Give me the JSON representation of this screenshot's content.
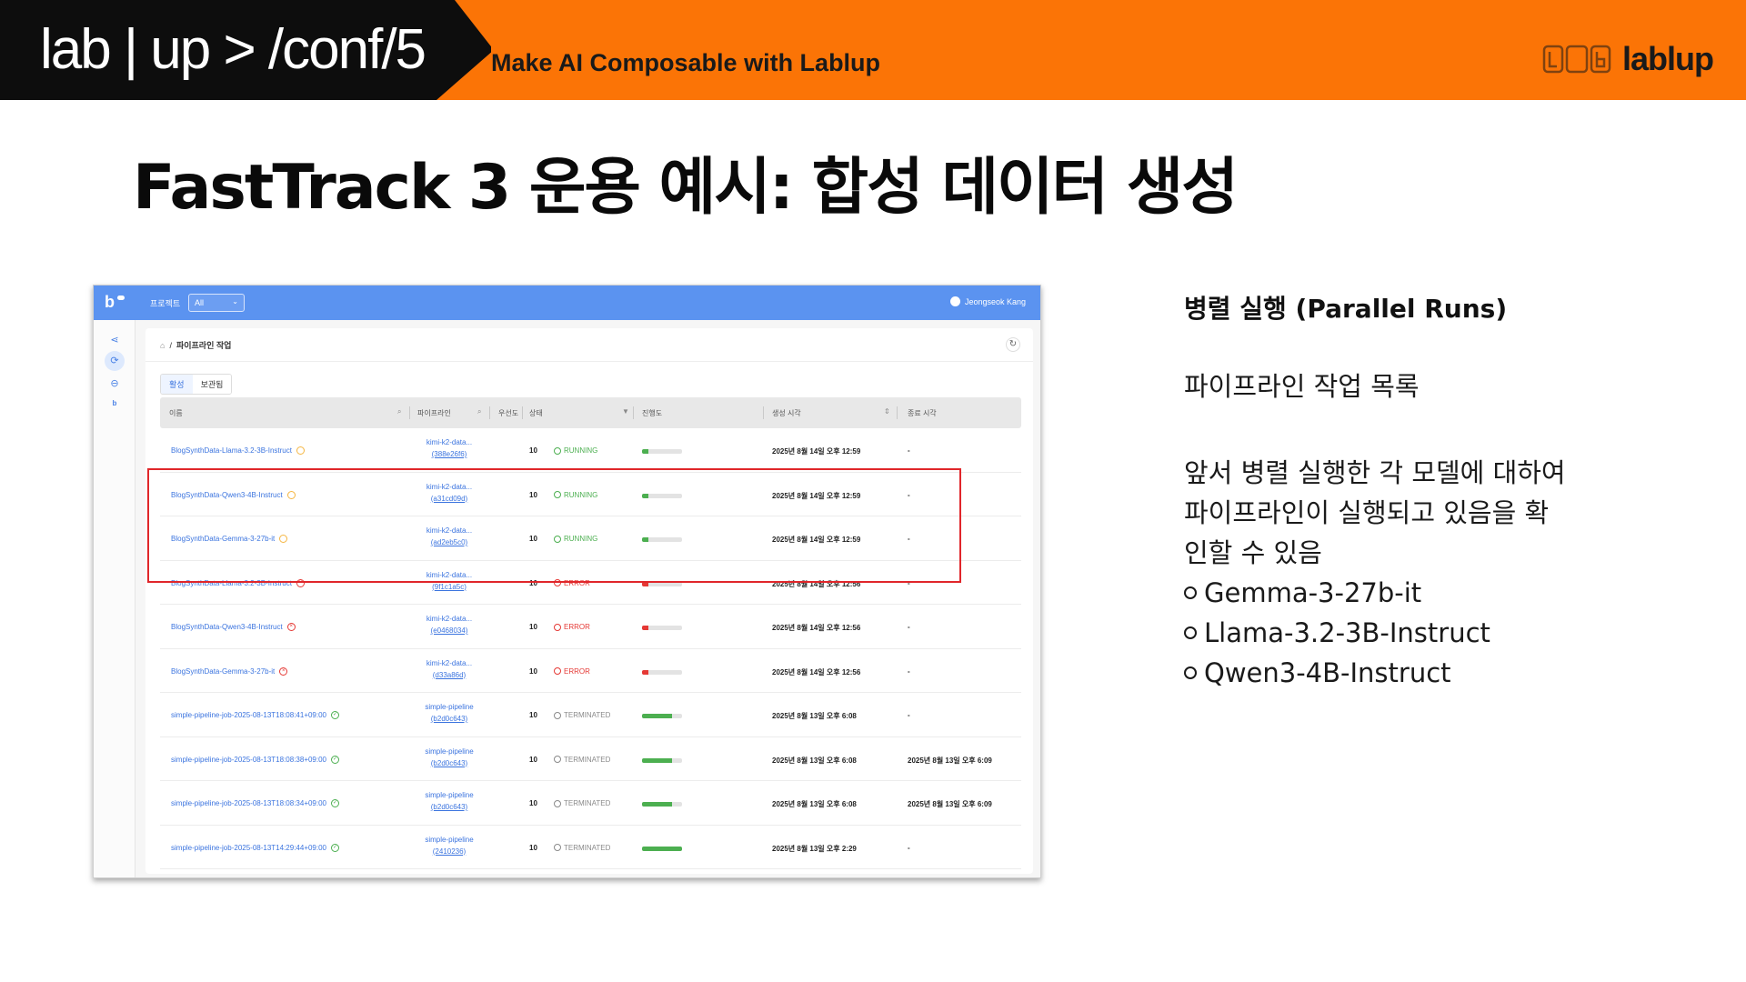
{
  "slide": {
    "brand": "lab | up > /conf/5",
    "tagline": "Make AI Composable with Lablup",
    "logo_word": "lablup",
    "title": "FastTrack 3 운용 예시: 합성 데이터 생성"
  },
  "side": {
    "heading": "병렬 실행 (Parallel Runs)",
    "subheading": "파이프라인 작업 목록",
    "description": "앞서 병렬 실행한 각 모델에 대하여 파이프라인이 실행되고 있음을 확인할 수 있음",
    "models": [
      "Gemma-3-27b-it",
      "Llama-3.2-3B-Instruct",
      "Qwen3-4B-Instruct"
    ]
  },
  "app": {
    "logo": "b",
    "project_label": "프로젝트",
    "project_value": "All",
    "user_name": "Jeongseok Kang",
    "breadcrumb_sep": "/",
    "breadcrumb_page": "파이프라인 작업",
    "tabs": [
      "활성",
      "보관됨"
    ],
    "active_tab": "활성",
    "colors": {
      "running": "#4caf50",
      "error": "#e53935",
      "terminated": "#8a8a8a",
      "link": "#3b74df",
      "topbar": "#5b93f0"
    },
    "columns": [
      "이름",
      "파이프라인",
      "우선도",
      "상태",
      "진행도",
      "생성 시각",
      "종료 시각"
    ],
    "jobs": [
      {
        "name": "BlogSynthData-Llama-3.2-3B-Instruct",
        "pipeline": "kimi-k2-data...",
        "pipeline_id": "(388e26f6)",
        "priority": "10",
        "status": "RUNNING",
        "progress": 0.15,
        "created": "2025년 8월 14일 오후 12:59",
        "ended": "-"
      },
      {
        "name": "BlogSynthData-Qwen3-4B-Instruct",
        "pipeline": "kimi-k2-data...",
        "pipeline_id": "(a31cd09d)",
        "priority": "10",
        "status": "RUNNING",
        "progress": 0.15,
        "created": "2025년 8월 14일 오후 12:59",
        "ended": "-"
      },
      {
        "name": "BlogSynthData-Gemma-3-27b-it",
        "pipeline": "kimi-k2-data...",
        "pipeline_id": "(ad2eb5c0)",
        "priority": "10",
        "status": "RUNNING",
        "progress": 0.15,
        "created": "2025년 8월 14일 오후 12:59",
        "ended": "-"
      },
      {
        "name": "BlogSynthData-Llama-3.2-3B-Instruct",
        "pipeline": "kimi-k2-data...",
        "pipeline_id": "(9f1c1a5c)",
        "priority": "10",
        "status": "ERROR",
        "progress": 0.15,
        "created": "2025년 8월 14일 오후 12:56",
        "ended": "-"
      },
      {
        "name": "BlogSynthData-Qwen3-4B-Instruct",
        "pipeline": "kimi-k2-data...",
        "pipeline_id": "(e0468034)",
        "priority": "10",
        "status": "ERROR",
        "progress": 0.15,
        "created": "2025년 8월 14일 오후 12:56",
        "ended": "-"
      },
      {
        "name": "BlogSynthData-Gemma-3-27b-it",
        "pipeline": "kimi-k2-data...",
        "pipeline_id": "(d33a86d)",
        "priority": "10",
        "status": "ERROR",
        "progress": 0.15,
        "created": "2025년 8월 14일 오후 12:56",
        "ended": "-"
      },
      {
        "name": "simple-pipeline-job-2025-08-13T18:08:41+09:00",
        "pipeline": "simple-pipeline",
        "pipeline_id": "(b2d0c643)",
        "priority": "10",
        "status": "TERMINATED",
        "progress": 0.75,
        "created": "2025년 8월 13일 오후 6:08",
        "ended": "-"
      },
      {
        "name": "simple-pipeline-job-2025-08-13T18:08:38+09:00",
        "pipeline": "simple-pipeline",
        "pipeline_id": "(b2d0c643)",
        "priority": "10",
        "status": "TERMINATED",
        "progress": 0.75,
        "created": "2025년 8월 13일 오후 6:08",
        "ended": "2025년 8월 13일 오후 6:09"
      },
      {
        "name": "simple-pipeline-job-2025-08-13T18:08:34+09:00",
        "pipeline": "simple-pipeline",
        "pipeline_id": "(b2d0c643)",
        "priority": "10",
        "status": "TERMINATED",
        "progress": 0.75,
        "created": "2025년 8월 13일 오후 6:08",
        "ended": "2025년 8월 13일 오후 6:09"
      },
      {
        "name": "simple-pipeline-job-2025-08-13T14:29:44+09:00",
        "pipeline": "simple-pipeline",
        "pipeline_id": "(2410236)",
        "priority": "10",
        "status": "TERMINATED",
        "progress": 1.0,
        "created": "2025년 8월 13일 오후 2:29",
        "ended": "-"
      }
    ]
  }
}
